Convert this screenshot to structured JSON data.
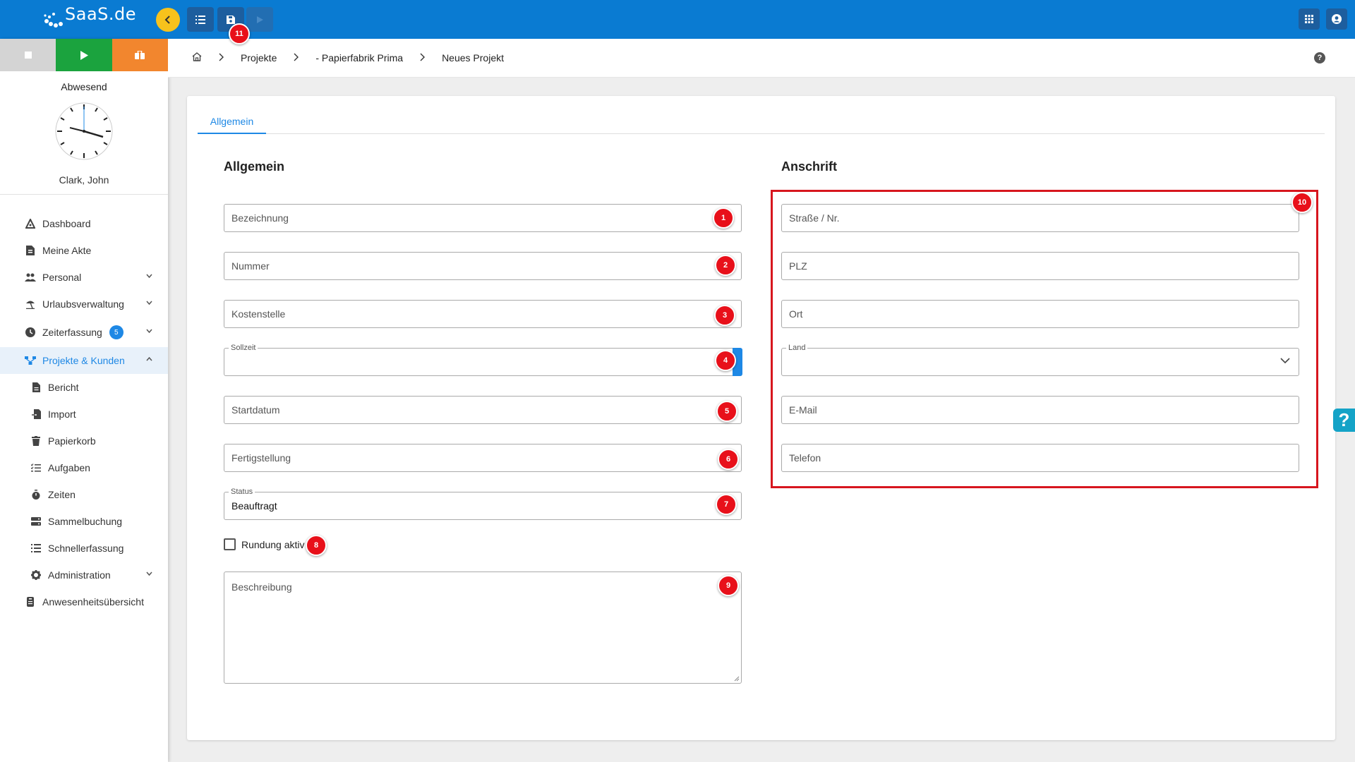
{
  "app": {
    "logo_text": "SaaS.de"
  },
  "toolbar": {
    "back_icon": "chevron-left-icon",
    "list_icon": "list-icon",
    "save_icon": "floppy-disk-icon",
    "run_icon": "play-icon",
    "apps_icon": "grid-icon",
    "account_icon": "account-circle-icon",
    "save_badge": "11"
  },
  "sidebar": {
    "status_buttons": [
      {
        "name": "stop",
        "icon": "stop-icon",
        "color": "#d4d4d4"
      },
      {
        "name": "start",
        "icon": "play-icon",
        "color": "#1ba33e"
      },
      {
        "name": "break",
        "icon": "suitcase-icon",
        "color": "#f2862e"
      }
    ],
    "presence_status": "Abwesend",
    "user_name": "Clark, John",
    "nav": [
      {
        "label": "Dashboard",
        "icon": "dashboard-icon"
      },
      {
        "label": "Meine Akte",
        "icon": "file-icon"
      },
      {
        "label": "Personal",
        "icon": "people-icon",
        "expandable": true
      },
      {
        "label": "Urlaubsverwaltung",
        "icon": "beach-icon",
        "expandable": true
      },
      {
        "label": "Zeiterfassung",
        "icon": "clock-icon",
        "expandable": true,
        "badge": "5"
      },
      {
        "label": "Projekte & Kunden",
        "icon": "hierarchy-icon",
        "expandable": true,
        "active": true
      },
      {
        "label": "Bericht",
        "icon": "report-icon",
        "sub": true
      },
      {
        "label": "Import",
        "icon": "import-icon",
        "sub": true
      },
      {
        "label": "Papierkorb",
        "icon": "trash-icon",
        "sub": true
      },
      {
        "label": "Aufgaben",
        "icon": "tasklist-icon",
        "sub": true
      },
      {
        "label": "Zeiten",
        "icon": "stopwatch-icon",
        "sub": true
      },
      {
        "label": "Sammelbuchung",
        "icon": "stack-icon",
        "sub": true
      },
      {
        "label": "Schnellerfassung",
        "icon": "quicklist-icon",
        "sub": true
      },
      {
        "label": "Administration",
        "icon": "gear-icon",
        "expandable": true
      },
      {
        "label": "Anwesenheitsübersicht",
        "icon": "badge-icon"
      }
    ]
  },
  "breadcrumb": {
    "home_icon": "home-icon",
    "items": [
      "Projekte",
      "- Papierfabrik Prima",
      "Neues Projekt"
    ],
    "help_icon": "help-circle-icon"
  },
  "tabs": [
    "Allgemein"
  ],
  "form": {
    "left_title": "Allgemein",
    "right_title": "Anschrift",
    "left_fields": [
      {
        "placeholder": "Bezeichnung",
        "badge": "1"
      },
      {
        "placeholder": "Nummer",
        "badge": "2"
      },
      {
        "placeholder": "Kostenstelle",
        "badge": "3"
      },
      {
        "label": "Sollzeit",
        "value": "",
        "badge": "4"
      },
      {
        "placeholder": "Startdatum",
        "badge": "5"
      },
      {
        "placeholder": "Fertigstellung",
        "badge": "6"
      },
      {
        "label": "Status",
        "value": "Beauftragt",
        "badge": "7"
      }
    ],
    "checkbox": {
      "label": "Rundung aktiv",
      "checked": false,
      "badge": "8"
    },
    "description": {
      "placeholder": "Beschreibung",
      "badge": "9"
    },
    "right_fields": [
      {
        "placeholder": "Straße / Nr."
      },
      {
        "placeholder": "PLZ"
      },
      {
        "placeholder": "Ort"
      },
      {
        "label": "Land",
        "value": ""
      },
      {
        "placeholder": "E-Mail"
      },
      {
        "placeholder": "Telefon"
      }
    ],
    "address_badge": "10"
  },
  "colors": {
    "topbar": "#0a7bd2",
    "accent": "#1e88e5",
    "badge": "#e8101a",
    "highlight": "#d7161e"
  }
}
